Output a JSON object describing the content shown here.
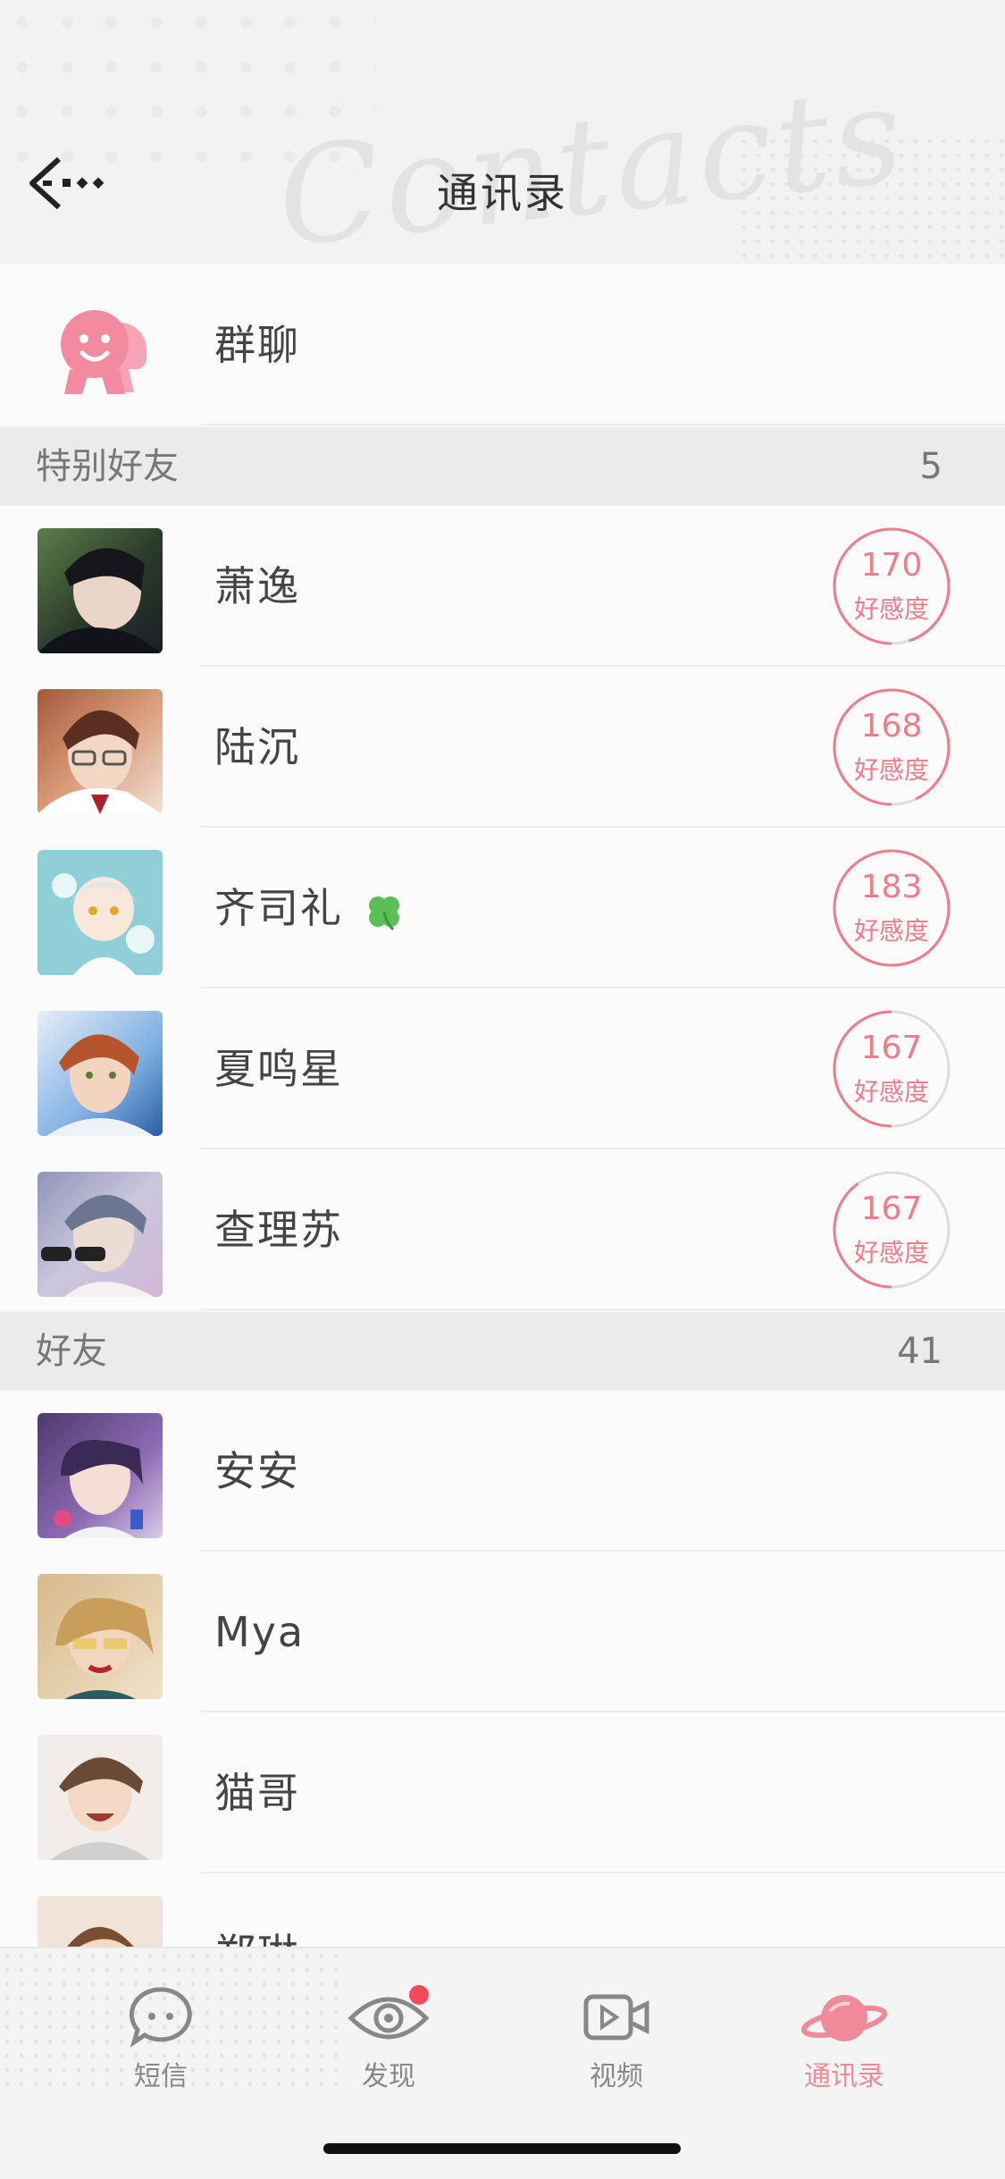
{
  "header": {
    "title": "通讯录",
    "watermark": "Contacts",
    "back_icon": "back-arrow-icon"
  },
  "group_chat": {
    "label": "群聊",
    "icon": "group-chat-icon"
  },
  "special_friends": {
    "title": "特别好友",
    "count": "5",
    "items": [
      {
        "name": "萧逸",
        "favor": "170",
        "favor_label": "好感度",
        "favor_fraction": 0.95
      },
      {
        "name": "陆沉",
        "favor": "168",
        "favor_label": "好感度",
        "favor_fraction": 0.93
      },
      {
        "name": "齐司礼",
        "favor": "183",
        "favor_label": "好感度",
        "favor_fraction": 1.0,
        "badge": "clover-icon"
      },
      {
        "name": "夏鸣星",
        "favor": "167",
        "favor_label": "好感度",
        "favor_fraction": 0.5
      },
      {
        "name": "查理苏",
        "favor": "167",
        "favor_label": "好感度",
        "favor_fraction": 0.4
      }
    ]
  },
  "friends": {
    "title": "好友",
    "count": "41",
    "items": [
      {
        "name": "安安"
      },
      {
        "name": "Mya"
      },
      {
        "name": "猫哥"
      },
      {
        "name": "郑琳"
      }
    ]
  },
  "tabs": [
    {
      "label": "短信",
      "icon": "message-bubble-icon",
      "active": false
    },
    {
      "label": "发现",
      "icon": "eye-icon",
      "active": false,
      "badge": true
    },
    {
      "label": "视频",
      "icon": "video-camera-icon",
      "active": false
    },
    {
      "label": "通讯录",
      "icon": "planet-icon",
      "active": true
    }
  ],
  "colors": {
    "accent": "#f08a98",
    "ring": "#ef7c88",
    "ring_track": "#dddddd",
    "section_bg": "#ebebeb"
  }
}
